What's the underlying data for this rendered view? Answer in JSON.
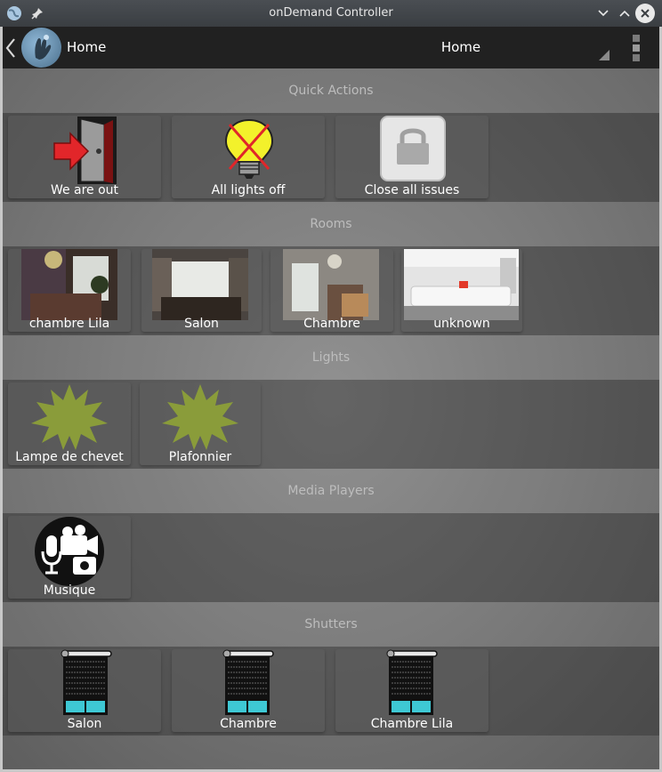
{
  "window": {
    "title": "onDemand Controller"
  },
  "appbar": {
    "title": "Home",
    "spinner_value": "Home"
  },
  "sections": {
    "quick_actions": "Quick Actions",
    "rooms": "Rooms",
    "lights": "Lights",
    "media_players": "Media Players",
    "shutters": "Shutters"
  },
  "quick_actions": [
    "We are out",
    "All lights off",
    "Close all issues"
  ],
  "rooms": [
    "chambre Lila",
    "Salon",
    "Chambre",
    "unknown"
  ],
  "lights": [
    "Lampe de chevet",
    "Plafonnier"
  ],
  "media_players": [
    "Musique"
  ],
  "shutters": [
    "Salon",
    "Chambre",
    "Chambre Lila"
  ],
  "colors": {
    "light_star": "#8a9c3a",
    "shutter_glass": "#3ec8d4",
    "appbar": "#212121"
  }
}
